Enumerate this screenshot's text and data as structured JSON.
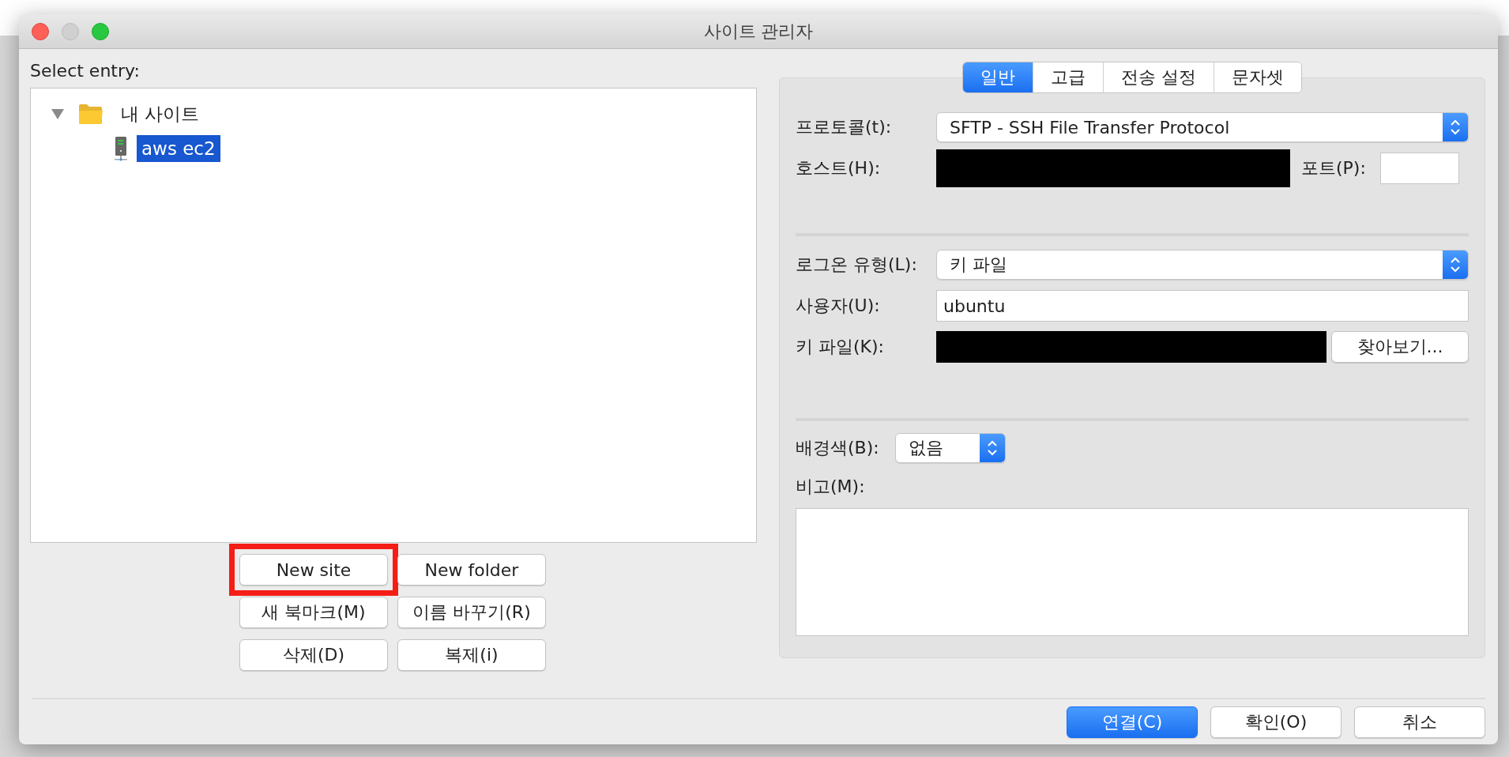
{
  "window": {
    "title": "사이트 관리자"
  },
  "site_list": {
    "label": "Select entry:",
    "tree": [
      {
        "label": "내 사이트",
        "kind": "folder",
        "expanded": true,
        "selected": false,
        "children": [
          {
            "label": "aws ec2",
            "kind": "server",
            "selected": true
          }
        ]
      }
    ]
  },
  "site_buttons": [
    {
      "label": "New site",
      "highlighted": true
    },
    {
      "label": "New folder",
      "highlighted": false
    },
    {
      "label": "새 북마크(M)",
      "highlighted": false
    },
    {
      "label": "이름 바꾸기(R)",
      "highlighted": false
    },
    {
      "label": "삭제(D)",
      "highlighted": false
    },
    {
      "label": "복제(i)",
      "highlighted": false
    }
  ],
  "tabs": [
    {
      "label": "일반",
      "selected": true
    },
    {
      "label": "고급",
      "selected": false
    },
    {
      "label": "전송 설정",
      "selected": false
    },
    {
      "label": "문자셋",
      "selected": false
    }
  ],
  "general": {
    "protocol": {
      "label": "프로토콜(t):",
      "value": "SFTP - SSH File Transfer Protocol"
    },
    "host": {
      "label": "호스트(H):",
      "redacted": true
    },
    "port": {
      "label": "포트(P):"
    },
    "logon_type": {
      "label": "로그온 유형(L):",
      "value": "키 파일"
    },
    "user": {
      "label": "사용자(U):",
      "value": "ubuntu"
    },
    "key_file": {
      "label": "키 파일(K):",
      "redacted": true,
      "browse": "찾아보기..."
    },
    "background_color": {
      "label": "배경색(B):",
      "value": "없음"
    },
    "comments": {
      "label": "비고(M):"
    }
  },
  "dialog_buttons": [
    {
      "label": "연결(C)",
      "default": true
    },
    {
      "label": "확인(O)",
      "default": false
    },
    {
      "label": "취소",
      "default": false
    }
  ]
}
